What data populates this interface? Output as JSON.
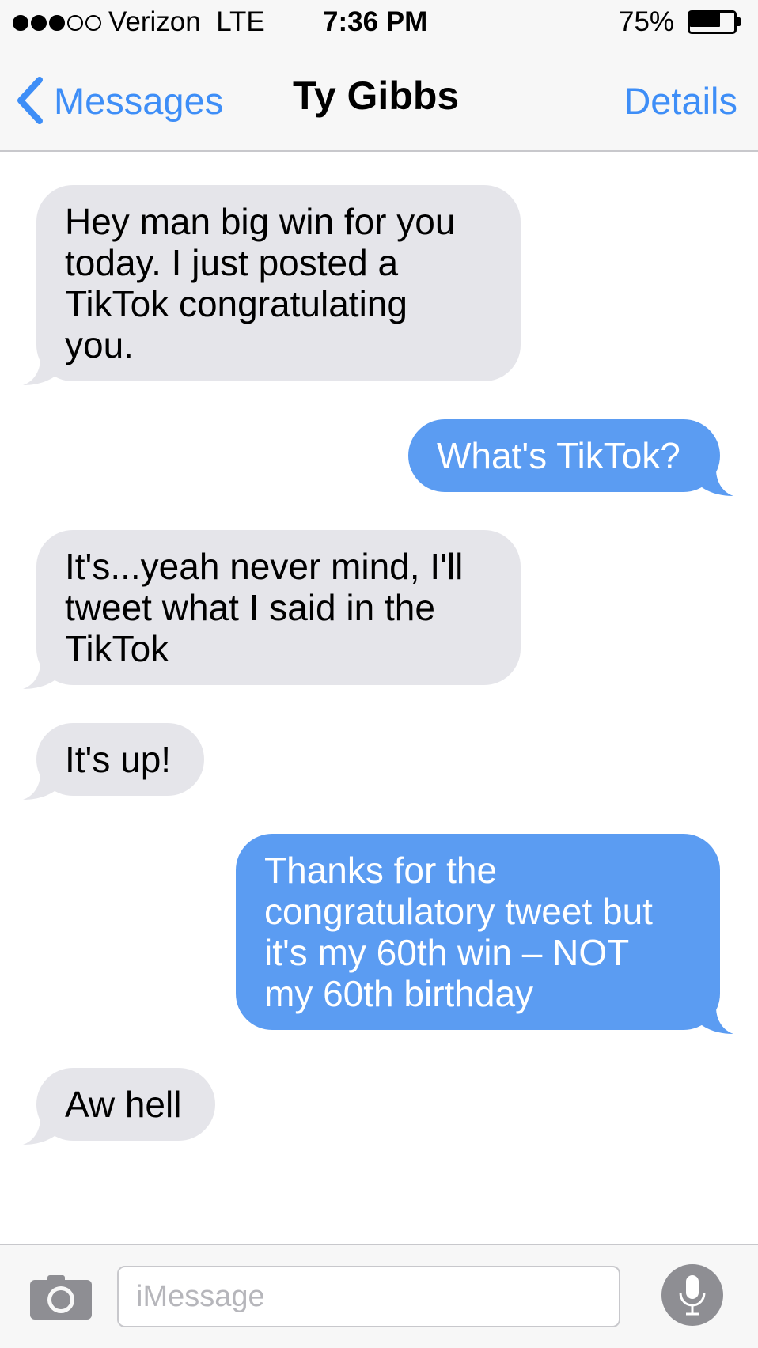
{
  "status_bar": {
    "signal_bars_filled": 3,
    "signal_bars_total": 5,
    "carrier": "Verizon  LTE",
    "time": "7:36 PM",
    "battery_percent": "75%",
    "battery_level": 0.75
  },
  "nav": {
    "back_label": "Messages",
    "title": "Ty Gibbs",
    "details_label": "Details",
    "accent_color": "#3e8ef7"
  },
  "messages": [
    {
      "sender": "contact",
      "text": "Hey man big win for you\ntoday. I just posted a\nTikTok congratulating\nyou."
    },
    {
      "sender": "me",
      "text": "What's TikTok?"
    },
    {
      "sender": "contact",
      "text": "It's...yeah never mind, I'll\ntweet what I said in the\nTikTok"
    },
    {
      "sender": "contact",
      "text": "It's up!"
    },
    {
      "sender": "me",
      "text": "Thanks for the\ncongratulatory tweet but\nit's my 60th win – NOT\nmy 60th birthday"
    },
    {
      "sender": "contact",
      "text": "Aw hell"
    }
  ],
  "composer": {
    "camera_icon": "camera-icon",
    "placeholder": "iMessage",
    "value": "",
    "mic_icon": "microphone-icon"
  },
  "colors": {
    "incoming_bubble": "#e5e5ea",
    "outgoing_bubble": "#5b9cf2",
    "bar_background": "#f7f7f7"
  }
}
